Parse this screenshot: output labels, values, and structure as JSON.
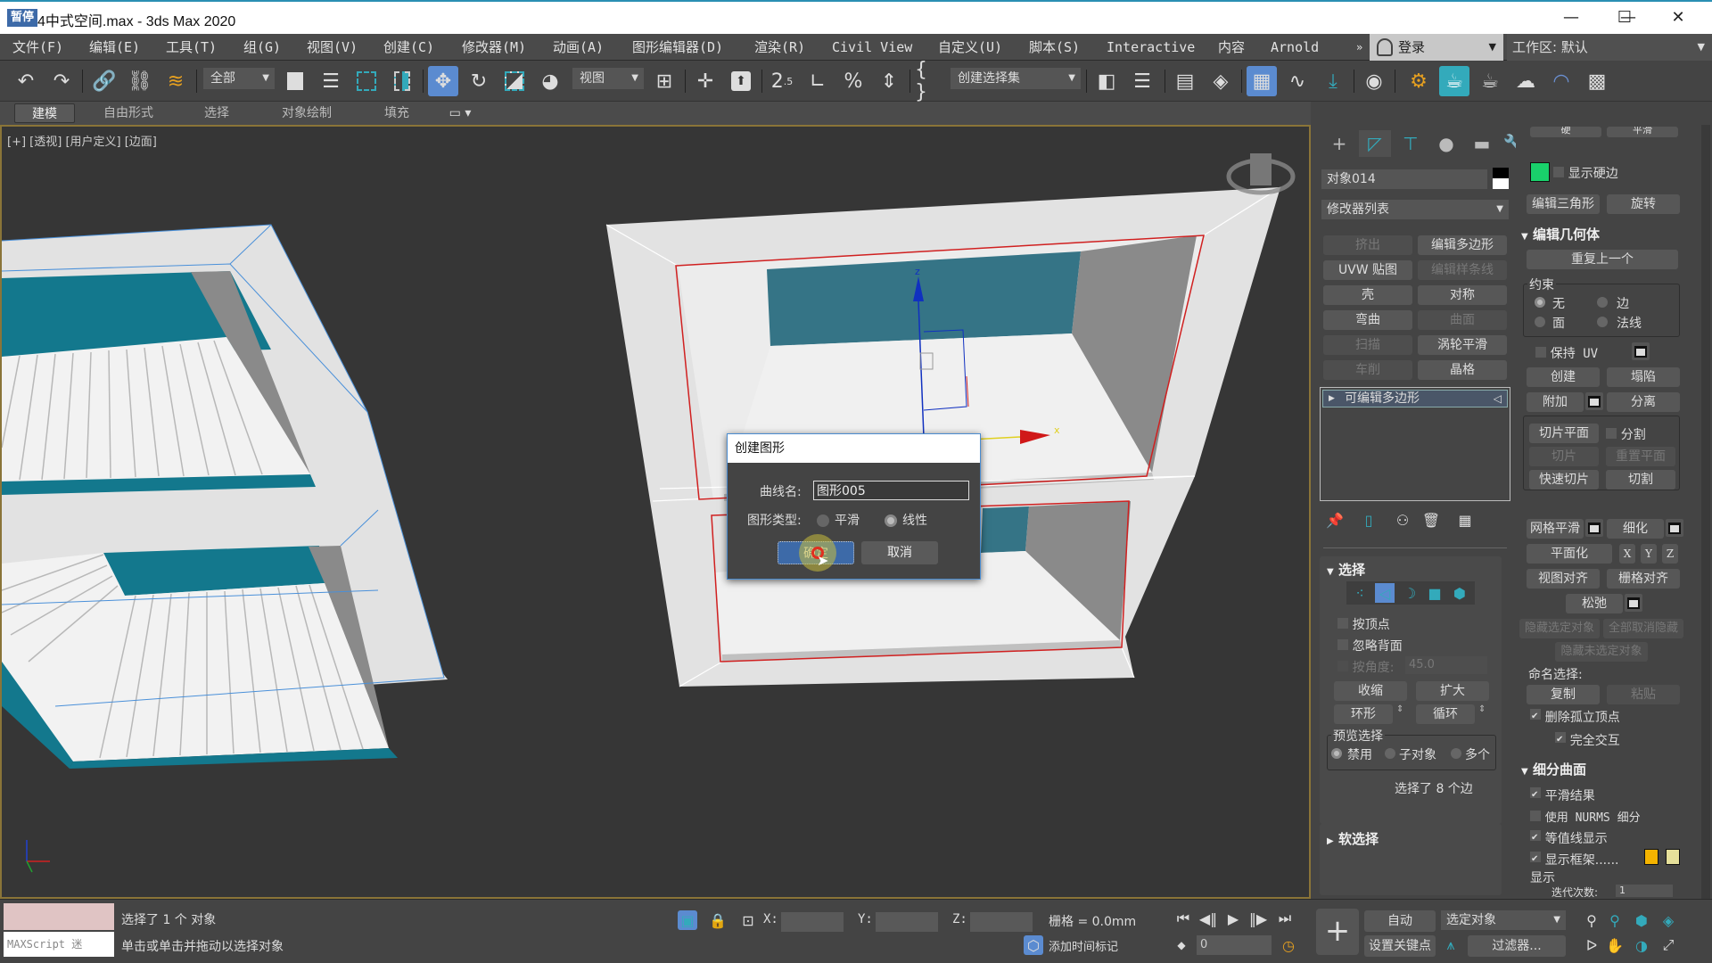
{
  "window": {
    "app_badge": "暂停",
    "title": "4中式空间.max - 3ds Max 2020",
    "minimize": "—",
    "maximize": "☐",
    "close": "✕"
  },
  "menubar": {
    "items": [
      "文件(F)",
      "编辑(E)",
      "工具(T)",
      "组(G)",
      "视图(V)",
      "创建(C)",
      "修改器(M)",
      "动画(A)",
      "图形编辑器(D)",
      "渲染(R)",
      "Civil View",
      "自定义(U)",
      "脚本(S)",
      "Interactive",
      "内容",
      "Arnold"
    ],
    "overflow": "»",
    "login_label": "登录",
    "workspace_label": "工作区: 默认"
  },
  "toolbar": {
    "selection_filter": "全部",
    "reference_coord": "视图",
    "named_selection_set": "创建选择集"
  },
  "ribbon": {
    "tabs": [
      "建模",
      "自由形式",
      "选择",
      "对象绘制",
      "填充"
    ],
    "active_tab": "建模"
  },
  "viewport": {
    "label": "[+] [透视] [用户定义] [边面]",
    "gizmo_x": "x",
    "gizmo_z": "z",
    "colors": {
      "background": "#363636",
      "wall": "#e2e2e2",
      "accent": "#13778d",
      "selection_edge": "#d02020"
    }
  },
  "dialog": {
    "title": "创建图形",
    "curve_name_label": "曲线名:",
    "curve_name_value": "图形005",
    "shape_type_label": "图形类型:",
    "shape_types": [
      {
        "label": "平滑",
        "selected": false
      },
      {
        "label": "线性",
        "selected": true
      }
    ],
    "ok_label": "确定",
    "cancel_label": "取消"
  },
  "command_panel": {
    "object_name": "对象014",
    "modifier_list": "修改器列表",
    "modifier_buttons": [
      {
        "label": "挤出",
        "enabled": false
      },
      {
        "label": "编辑多边形",
        "enabled": true
      },
      {
        "label": "UVW 贴图",
        "enabled": true
      },
      {
        "label": "编辑样条线",
        "enabled": false
      },
      {
        "label": "壳",
        "enabled": true
      },
      {
        "label": "对称",
        "enabled": true
      },
      {
        "label": "弯曲",
        "enabled": true
      },
      {
        "label": "曲面",
        "enabled": false
      },
      {
        "label": "扫描",
        "enabled": false
      },
      {
        "label": "涡轮平滑",
        "enabled": true
      },
      {
        "label": "车削",
        "enabled": false
      },
      {
        "label": "晶格",
        "enabled": true
      }
    ],
    "stack_item": "可编辑多边形",
    "selection": {
      "title": "选择",
      "by_vertex": "按顶点",
      "ignore_backfacing": "忽略背面",
      "by_angle": "按角度:",
      "angle_value": "45.0",
      "shrink": "收缩",
      "grow": "扩大",
      "ring": "环形",
      "loop": "循环",
      "preview_title": "预览选择",
      "preview_options": [
        {
          "label": "禁用",
          "selected": true
        },
        {
          "label": "子对象",
          "selected": false
        },
        {
          "label": "多个",
          "selected": false
        }
      ],
      "status": "选择了 8 个边"
    },
    "soft_selection_title": "软选择"
  },
  "right_column": {
    "partial_buttons": [
      "硬",
      "平滑"
    ],
    "show_hard_edges": "显示硬边",
    "hard_edge_color": "#19d16b",
    "edit_triangulation": "编辑三角形",
    "turn": "旋转",
    "edit_geometry_title": "编辑几何体",
    "repeat_last": "重复上一个",
    "constraints_title": "约束",
    "constraints": [
      {
        "label": "无",
        "selected": true
      },
      {
        "label": "边",
        "selected": false
      },
      {
        "label": "面",
        "selected": false
      },
      {
        "label": "法线",
        "selected": false
      }
    ],
    "preserve_uv": "保持 UV",
    "create": "创建",
    "collapse": "塌陷",
    "attach": "附加",
    "detach": "分离",
    "slice_plane": "切片平面",
    "split": "分割",
    "slice": "切片",
    "reset_plane": "重置平面",
    "quickslice": "快速切片",
    "cut": "切割",
    "meshsmooth": "网格平滑",
    "tessellate": "细化",
    "make_planar": "平面化",
    "axes": [
      "X",
      "Y",
      "Z"
    ],
    "view_align": "视图对齐",
    "grid_align": "栅格对齐",
    "relax": "松弛",
    "hide_selected": "隐藏选定对象",
    "unhide_all": "全部取消隐藏",
    "hide_unselected": "隐藏未选定对象",
    "named_selections": "命名选择:",
    "copy": "复制",
    "paste": "粘贴",
    "delete_isolated": "删除孤立顶点",
    "full_interactivity": "完全交互",
    "subdivision_title": "细分曲面",
    "smooth_result": "平滑结果",
    "use_nurms": "使用 NURMS 细分",
    "isoline_display": "等值线显示",
    "show_cage": "显示框架......",
    "cage_colors": [
      "#f5b400",
      "#e6e09a"
    ],
    "display_label": "显示",
    "iterations_label": "迭代次数:",
    "iterations_value": "1"
  },
  "statusbar": {
    "maxscript_label": "MAXScript 迷",
    "selection_status": "选择了 1 个 对象",
    "prompt": "单击或单击并拖动以选择对象",
    "x_label": "X:",
    "y_label": "Y:",
    "z_label": "Z:",
    "x_value": "",
    "y_value": "",
    "z_value": "",
    "grid": "栅格 = 0.0mm",
    "add_time_tag": "添加时间标记",
    "frame_value": "0",
    "auto_key": "自动",
    "set_key": "设置关键点",
    "key_filter_dropdown": "选定对象",
    "filters": "过滤器..."
  }
}
